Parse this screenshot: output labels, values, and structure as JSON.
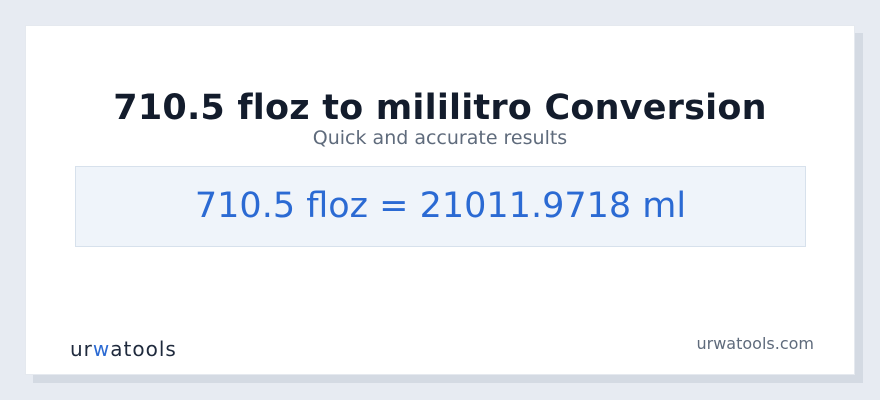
{
  "page": {
    "title": "710.5 floz to mililitro Conversion",
    "subtitle": "Quick and accurate results",
    "result": "710.5 floz = 21011.9718 ml"
  },
  "footer": {
    "logo_text_1": "ur",
    "logo_text_accent": "w",
    "logo_text_2": "atools",
    "site": "urwatools.com"
  },
  "colors": {
    "accent": "#2b6ad3",
    "title": "#131c2c",
    "muted": "#5f6b7c",
    "result_bg": "#eff4fa"
  }
}
